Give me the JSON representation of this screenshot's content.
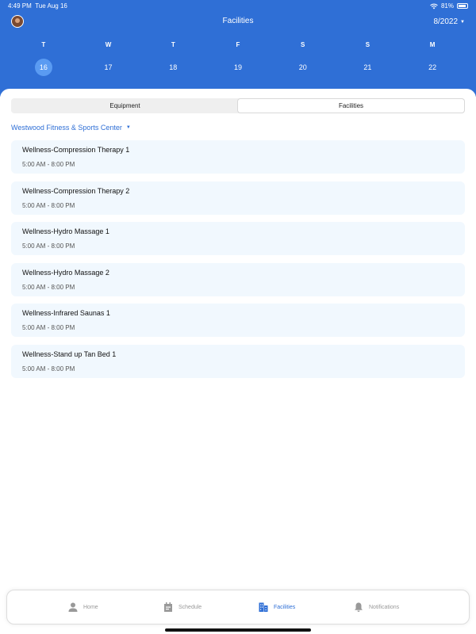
{
  "status": {
    "time": "4:49 PM",
    "date": "Tue Aug 16",
    "battery": "81%"
  },
  "header": {
    "title": "Facilities",
    "month": "8/2022"
  },
  "week": {
    "days": [
      "T",
      "W",
      "T",
      "F",
      "S",
      "S",
      "M"
    ],
    "dates": [
      "16",
      "17",
      "18",
      "19",
      "20",
      "21",
      "22"
    ],
    "selected_index": 0
  },
  "segment": {
    "tabs": [
      "Equipment",
      "Facilities"
    ],
    "active_index": 1
  },
  "location": {
    "name": "Westwood Fitness & Sports Center"
  },
  "facilities": [
    {
      "name": "Wellness-Compression Therapy 1",
      "hours": "5:00 AM - 8:00 PM"
    },
    {
      "name": "Wellness-Compression Therapy 2",
      "hours": "5:00 AM - 8:00 PM"
    },
    {
      "name": "Wellness-Hydro Massage 1",
      "hours": "5:00 AM - 8:00 PM"
    },
    {
      "name": "Wellness-Hydro Massage 2",
      "hours": "5:00 AM - 8:00 PM"
    },
    {
      "name": "Wellness-Infrared Saunas 1",
      "hours": "5:00 AM - 8:00 PM"
    },
    {
      "name": "Wellness-Stand up Tan Bed 1",
      "hours": "5:00 AM - 8:00 PM"
    }
  ],
  "tabbar": {
    "items": [
      {
        "label": "Home",
        "icon": "person-icon"
      },
      {
        "label": "Schedule",
        "icon": "calendar-icon"
      },
      {
        "label": "Facilities",
        "icon": "building-icon"
      },
      {
        "label": "Notifications",
        "icon": "bell-icon"
      }
    ],
    "active_index": 2
  },
  "colors": {
    "primary": "#2f6fd6",
    "selected_date": "#5a9bf2",
    "card_bg": "#f1f8fe"
  }
}
